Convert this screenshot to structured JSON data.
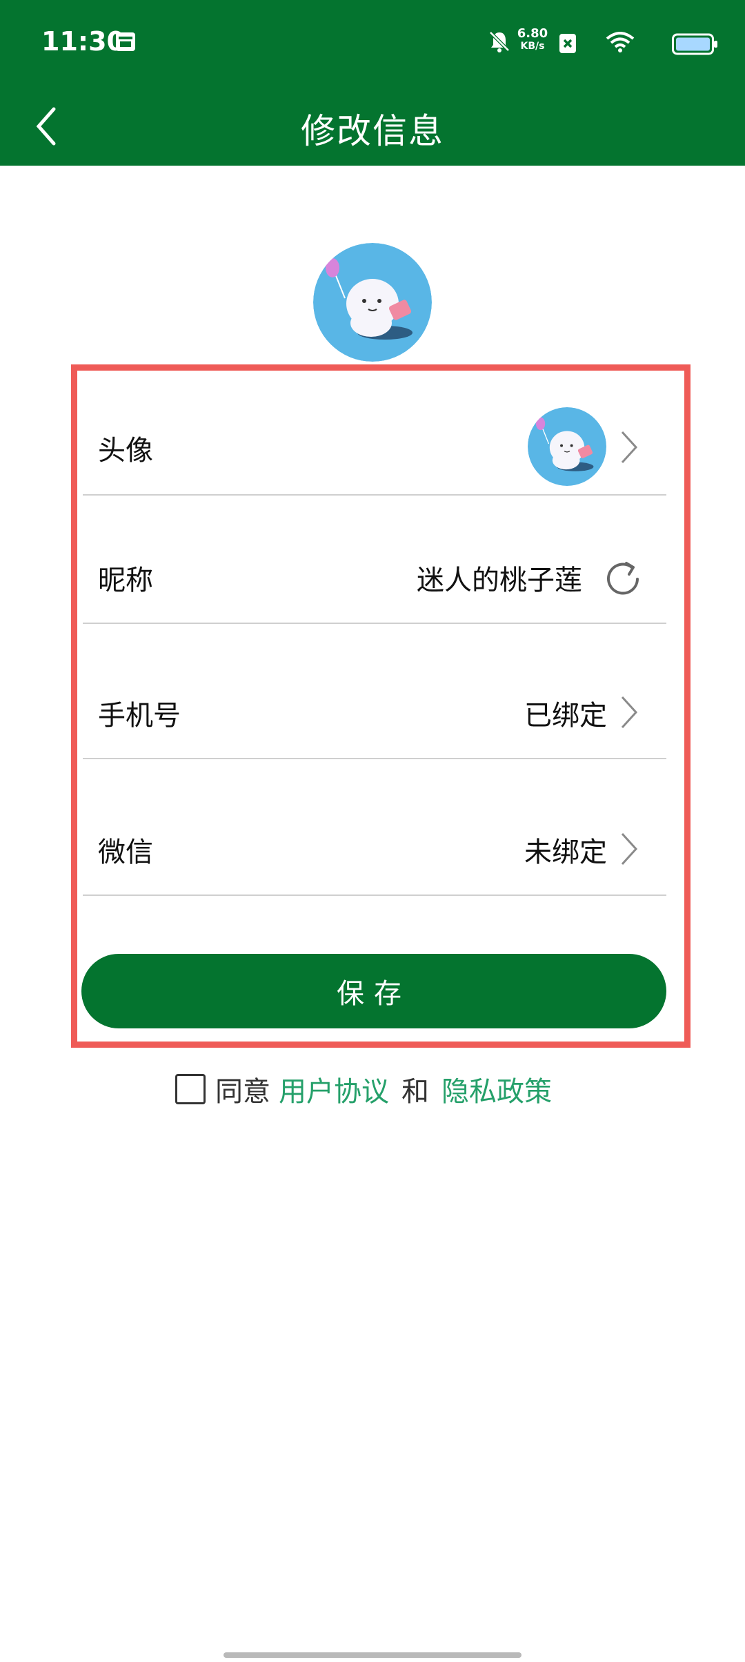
{
  "status_bar": {
    "time": "11:30",
    "net_speed": "6.80",
    "net_speed_unit": "KB/s"
  },
  "header": {
    "title": "修改信息"
  },
  "form": {
    "avatar_label": "头像",
    "nickname_label": "昵称",
    "nickname_value": "迷人的桃子莲",
    "phone_label": "手机号",
    "phone_value": "已绑定",
    "wechat_label": "微信",
    "wechat_value": "未绑定",
    "save_label": "保存"
  },
  "agreement": {
    "prefix": "同意",
    "user_agreement": "用户协议",
    "and": "和",
    "privacy_policy": "隐私政策"
  },
  "colors": {
    "brand_green": "#04742f",
    "link_green": "#25a06a",
    "highlight_red": "#ef5b57"
  },
  "icons": [
    "back-arrow-icon",
    "calendar-icon",
    "bell-muted-icon",
    "sim-x-icon",
    "wifi-icon",
    "battery-icon",
    "chevron-right-icon",
    "refresh-icon"
  ]
}
